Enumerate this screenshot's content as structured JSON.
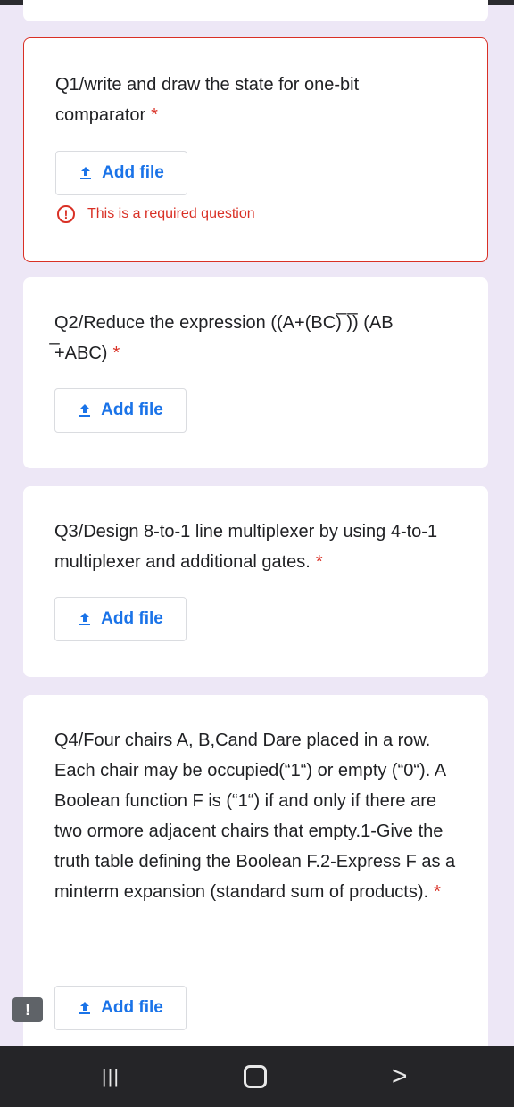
{
  "questions": [
    {
      "text": "Q1/write and draw the state for one-bit comparator",
      "required_mark": "*",
      "add_file_label": "Add file",
      "error_message": "This is a required question",
      "error_icon": "!"
    },
    {
      "text": "Q2/Reduce the expression ((A+(BC)̅ )̅) (AB ̅+ABC)",
      "required_mark": "*",
      "add_file_label": "Add file"
    },
    {
      "text": "Q3/Design 8-to-1 line multiplexer by using 4-to-1 multiplexer and additional gates.",
      "required_mark": "*",
      "add_file_label": "Add file"
    },
    {
      "text": "Q4/Four chairs A, B,Cand Dare placed in a row. Each chair may be occupied(“1“) or empty (“0“). A Boolean function F is (“1“) if and only if there are two ormore adjacent chairs that empty.1-Give the truth table defining the Boolean F.2-Express F as a minterm expansion (standard sum of products).",
      "required_mark": "*",
      "add_file_label": "Add file"
    }
  ],
  "feedback_button": "!",
  "nav": {
    "recents_glyph": "|||",
    "back_glyph": "<"
  },
  "colors": {
    "background": "#ede7f6",
    "accent": "#1a73e8",
    "error": "#d93025",
    "navbar": "#252528"
  },
  "icons": [
    "upload-icon",
    "error-icon",
    "feedback-icon",
    "home-icon"
  ]
}
